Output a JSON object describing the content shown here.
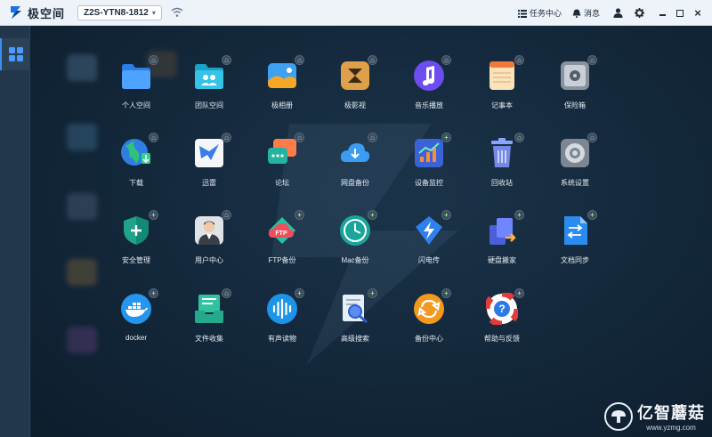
{
  "header": {
    "app_name": "极空间",
    "device": "Z2S-YTN8-1812",
    "task_center": "任务中心",
    "messages": "消息"
  },
  "apps": [
    {
      "label": "个人空间",
      "icon": "folder-icon",
      "badge": "share"
    },
    {
      "label": "团队空间",
      "icon": "team-folder-icon",
      "badge": "share"
    },
    {
      "label": "极相册",
      "icon": "photo-album-icon",
      "badge": "share"
    },
    {
      "label": "极影视",
      "icon": "video-icon",
      "badge": "share"
    },
    {
      "label": "音乐播放",
      "icon": "music-icon",
      "badge": "share"
    },
    {
      "label": "记事本",
      "icon": "notepad-icon",
      "badge": "share"
    },
    {
      "label": "保险箱",
      "icon": "safe-icon",
      "badge": "share"
    },
    {
      "label": "下载",
      "icon": "download-globe-icon",
      "badge": "share"
    },
    {
      "label": "迅雷",
      "icon": "thunder-icon",
      "badge": "share"
    },
    {
      "label": "论坛",
      "icon": "forum-icon",
      "badge": "share"
    },
    {
      "label": "网盘备份",
      "icon": "cloud-backup-icon",
      "badge": "share"
    },
    {
      "label": "设备监控",
      "icon": "monitor-chart-icon",
      "badge": "plus"
    },
    {
      "label": "回收站",
      "icon": "trash-icon",
      "badge": "share"
    },
    {
      "label": "系统设置",
      "icon": "settings-icon",
      "badge": "share"
    },
    {
      "label": "安全管理",
      "icon": "shield-icon",
      "badge": "plus"
    },
    {
      "label": "用户中心",
      "icon": "user-icon",
      "badge": "share"
    },
    {
      "label": "FTP备份",
      "icon": "ftp-cloud-icon",
      "badge": "plus"
    },
    {
      "label": "Mac备份",
      "icon": "time-machine-icon",
      "badge": "plus"
    },
    {
      "label": "闪电传",
      "icon": "lightning-icon",
      "badge": "plus"
    },
    {
      "label": "硬盘搬家",
      "icon": "disk-move-icon",
      "badge": "plus"
    },
    {
      "label": "文档同步",
      "icon": "doc-sync-icon",
      "badge": "plus"
    },
    {
      "label": "docker",
      "icon": "docker-icon",
      "badge": "plus"
    },
    {
      "label": "文件收集",
      "icon": "file-collect-icon",
      "badge": "share"
    },
    {
      "label": "有声读物",
      "icon": "audiobook-icon",
      "badge": "plus"
    },
    {
      "label": "高级搜索",
      "icon": "advanced-search-icon",
      "badge": "plus"
    },
    {
      "label": "备份中心",
      "icon": "backup-center-icon",
      "badge": "plus"
    },
    {
      "label": "帮助与反馈",
      "icon": "help-icon",
      "badge": "plus"
    }
  ],
  "watermark": {
    "title": "亿智蘑菇",
    "url": "www.yzmg.com"
  },
  "colors": {
    "accent": "#3d8ef0",
    "topbar": "#eef3fa",
    "desktop": "#13273a"
  }
}
